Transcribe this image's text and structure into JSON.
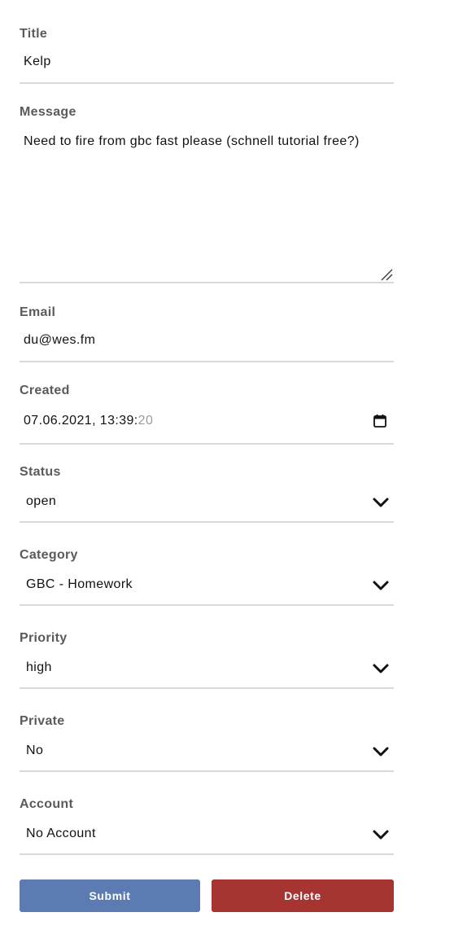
{
  "form": {
    "title": {
      "label": "Title",
      "value": "Kelp"
    },
    "message": {
      "label": "Message",
      "value": "Need to fire from gbc fast please (schnell tutorial free?)"
    },
    "email": {
      "label": "Email",
      "value": "du@wes.fm"
    },
    "created": {
      "label": "Created",
      "value_main": "07.06.2021, 13:39:",
      "value_seconds": "20",
      "icon": "calendar-icon"
    },
    "status": {
      "label": "Status",
      "selected": "open",
      "icon": "chevron-down-icon"
    },
    "category": {
      "label": "Category",
      "selected": "GBC - Homework",
      "icon": "chevron-down-icon"
    },
    "priority": {
      "label": "Priority",
      "selected": "high",
      "icon": "chevron-down-icon"
    },
    "private": {
      "label": "Private",
      "selected": "No",
      "icon": "chevron-down-icon"
    },
    "account": {
      "label": "Account",
      "selected": "No Account",
      "icon": "chevron-down-icon"
    }
  },
  "buttons": {
    "submit_label": "Submit",
    "delete_label": "Delete"
  },
  "colors": {
    "submit": "#5b7bb2",
    "delete": "#a63431",
    "label": "#5a5a5a",
    "underline": "#d9d9d9"
  }
}
